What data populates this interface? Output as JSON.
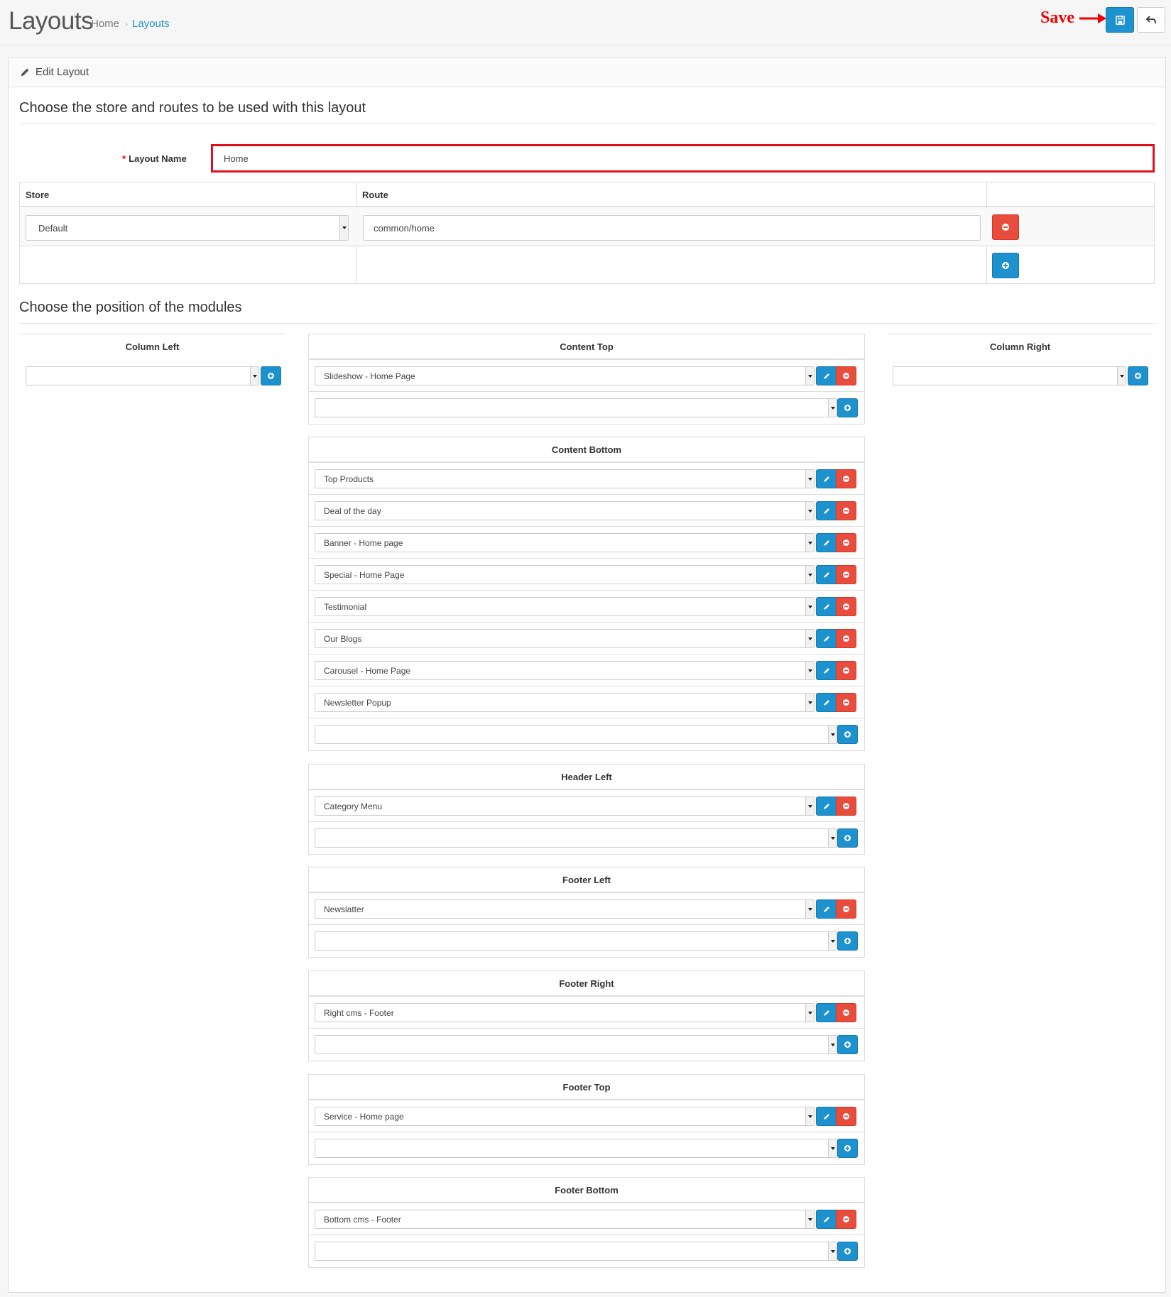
{
  "header": {
    "title": "Layouts",
    "breadcrumb": {
      "home": "Home",
      "separator": "›",
      "current": "Layouts"
    },
    "annotation": "Save",
    "save_icon": "save-icon",
    "back_icon": "reply-icon"
  },
  "panel": {
    "title": "Edit Layout",
    "icon": "pencil-icon"
  },
  "form": {
    "legend_routes": "Choose the store and routes to be used with this layout",
    "layout_name_required": "*",
    "layout_name_label": "Layout Name",
    "layout_name_value": "Home",
    "route_table": {
      "store_header": "Store",
      "route_header": "Route",
      "store_value": "Default",
      "route_value": "common/home"
    },
    "legend_modules": "Choose the position of the modules"
  },
  "modules": {
    "column_left": {
      "title": "Column Left",
      "selected": ""
    },
    "column_right": {
      "title": "Column Right",
      "selected": ""
    },
    "content_top": {
      "title": "Content Top",
      "items": [
        "Slideshow - Home Page"
      ]
    },
    "content_bottom": {
      "title": "Content Bottom",
      "items": [
        "Top Products",
        "Deal of the day",
        "Banner - Home page",
        "Special - Home Page",
        "Testimonial",
        "Our Blogs",
        "Carousel - Home Page",
        "Newsletter Popup"
      ]
    },
    "header_left": {
      "title": "Header Left",
      "items": [
        "Category Menu"
      ]
    },
    "footer_left": {
      "title": "Footer Left",
      "items": [
        "Newslatter"
      ]
    },
    "footer_right": {
      "title": "Footer Right",
      "items": [
        "Right cms - Footer"
      ]
    },
    "footer_top": {
      "title": "Footer Top",
      "items": [
        "Service - Home page"
      ]
    },
    "footer_bottom": {
      "title": "Footer Bottom",
      "items": [
        "Bottom cms - Footer"
      ]
    }
  },
  "colors": {
    "primary": "#1e91cf",
    "danger": "#e74c3c",
    "highlight": "#e0101a"
  }
}
